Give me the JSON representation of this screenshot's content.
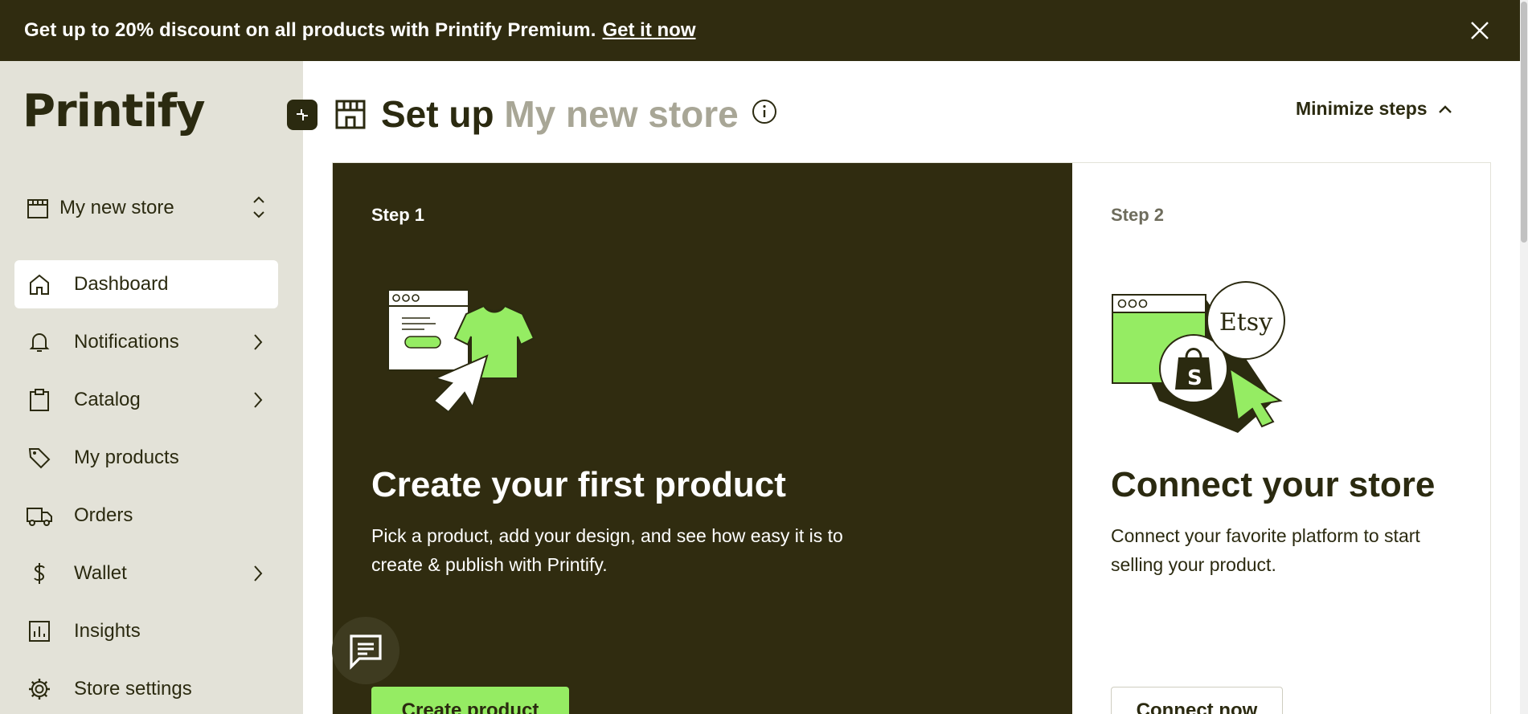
{
  "banner": {
    "text": "Get up to 20% discount on all products with Printify Premium.",
    "link": "Get it now"
  },
  "sidebar": {
    "logo": "Printify",
    "store_name": "My new store",
    "items": [
      {
        "label": "Dashboard",
        "icon": "home-icon",
        "active": true
      },
      {
        "label": "Notifications",
        "icon": "bell-icon",
        "has_arrow": true
      },
      {
        "label": "Catalog",
        "icon": "clipboard-icon",
        "has_arrow": true
      },
      {
        "label": "My products",
        "icon": "tag-icon"
      },
      {
        "label": "Orders",
        "icon": "truck-icon"
      },
      {
        "label": "Wallet",
        "icon": "dollar-icon",
        "has_arrow": true
      },
      {
        "label": "Insights",
        "icon": "chart-icon"
      },
      {
        "label": "Store settings",
        "icon": "gear-icon"
      }
    ]
  },
  "header": {
    "title_prefix": "Set up",
    "title_store": "My new store",
    "minimize_label": "Minimize steps"
  },
  "steps": [
    {
      "label": "Step 1",
      "heading": "Create your first product",
      "description": "Pick a product, add your design, and see how easy it is to create & publish with Printify.",
      "button": "Create product"
    },
    {
      "label": "Step 2",
      "heading": "Connect your store",
      "description": "Connect your favorite platform to start selling your product.",
      "button": "Connect now",
      "badge": "Etsy"
    }
  ],
  "colors": {
    "dark": "#302c10",
    "accent": "#95ec63",
    "sidebar_bg": "#e3e2d8",
    "muted": "#a8a696"
  }
}
